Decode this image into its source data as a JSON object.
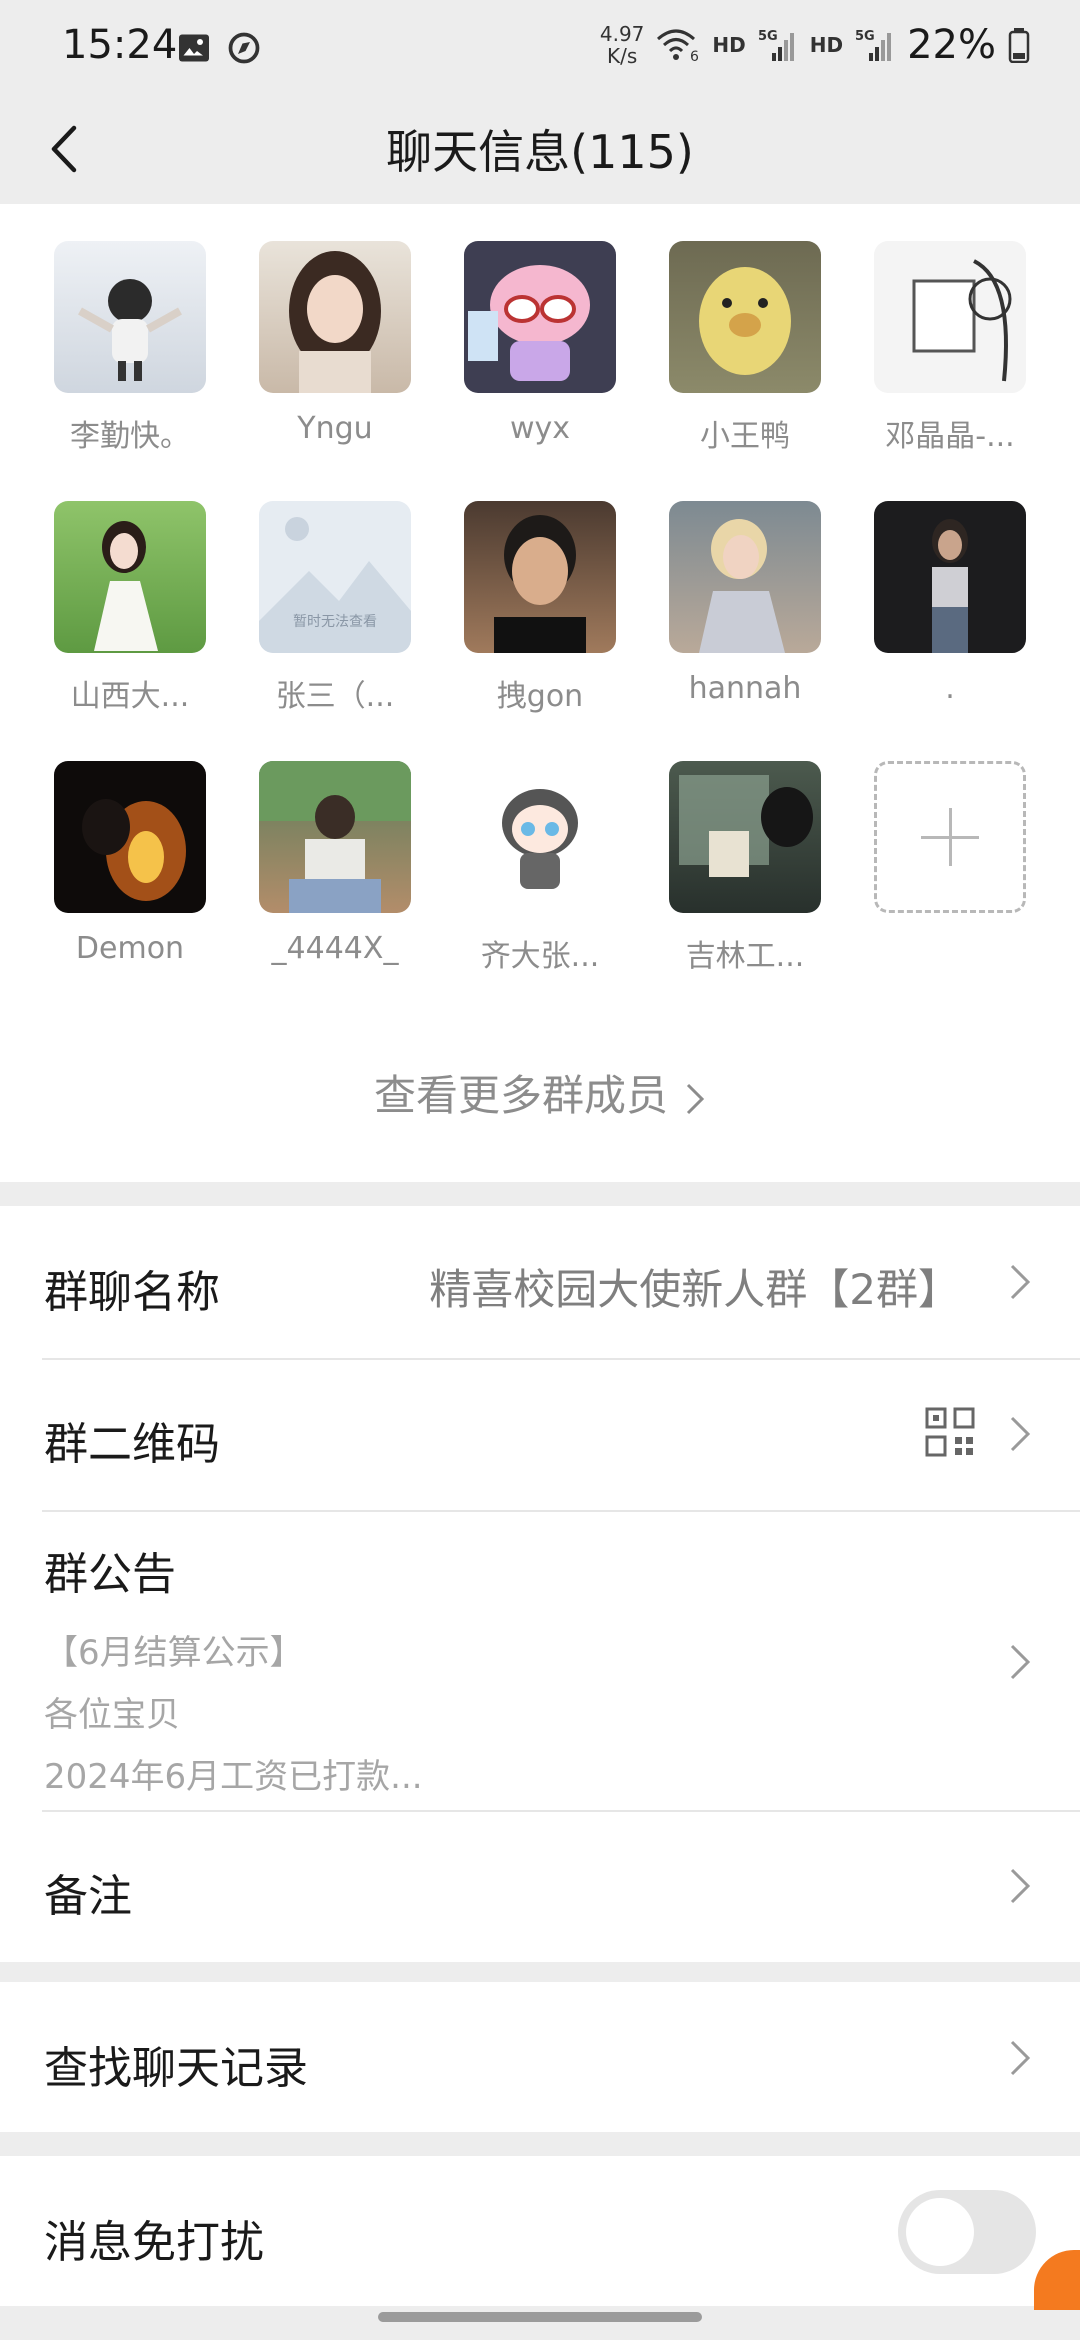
{
  "status_bar": {
    "time": "15:24",
    "net_speed_value": "4.97",
    "net_speed_unit": "K/s",
    "wifi_badge": "6",
    "hd1": "HD",
    "sig1": "5G",
    "hd2": "HD",
    "sig2": "5G",
    "battery": "22%"
  },
  "header": {
    "title": "聊天信息(115)"
  },
  "members": [
    {
      "name": "李勤快。",
      "avatar": "child-photo"
    },
    {
      "name": "Yngu",
      "avatar": "woman-photo"
    },
    {
      "name": "wyx",
      "avatar": "cartoon-pink-sheep"
    },
    {
      "name": "小王鸭",
      "avatar": "duckling-photo"
    },
    {
      "name": "邓晶晶-...",
      "avatar": "sketch-girl-reading"
    },
    {
      "name": "山西大...",
      "avatar": "girl-white-dress"
    },
    {
      "name": "张三（...",
      "avatar": "image-unavailable",
      "placeholder_text": "暂时无法查看"
    },
    {
      "name": "拽gon",
      "avatar": "man-portrait"
    },
    {
      "name": "hannah",
      "avatar": "blonde-woman"
    },
    {
      "name": ".",
      "avatar": "woman-night"
    },
    {
      "name": "Demon",
      "avatar": "dark-fire"
    },
    {
      "name": "_4444X_",
      "avatar": "person-supermarket"
    },
    {
      "name": "齐大张...",
      "avatar": "chibi-anime"
    },
    {
      "name": "吉林工...",
      "avatar": "person-train-reading"
    }
  ],
  "view_more": "查看更多群成员",
  "rows": {
    "group_name_label": "群聊名称",
    "group_name_value": "精喜校园大使新人群【2群】",
    "qr_label": "群二维码",
    "notice_label": "群公告",
    "notice_line1": "【6月结算公示】",
    "notice_line2": "各位宝贝",
    "notice_line3": "2024年6月工资已打款...",
    "remark_label": "备注",
    "search_label": "查找聊天记录",
    "mute_label": "消息免打扰"
  },
  "colors": {
    "background": "#ededed",
    "card": "#ffffff",
    "secondary_text": "#8c8c8c",
    "accent_orange": "#f47a1f"
  }
}
